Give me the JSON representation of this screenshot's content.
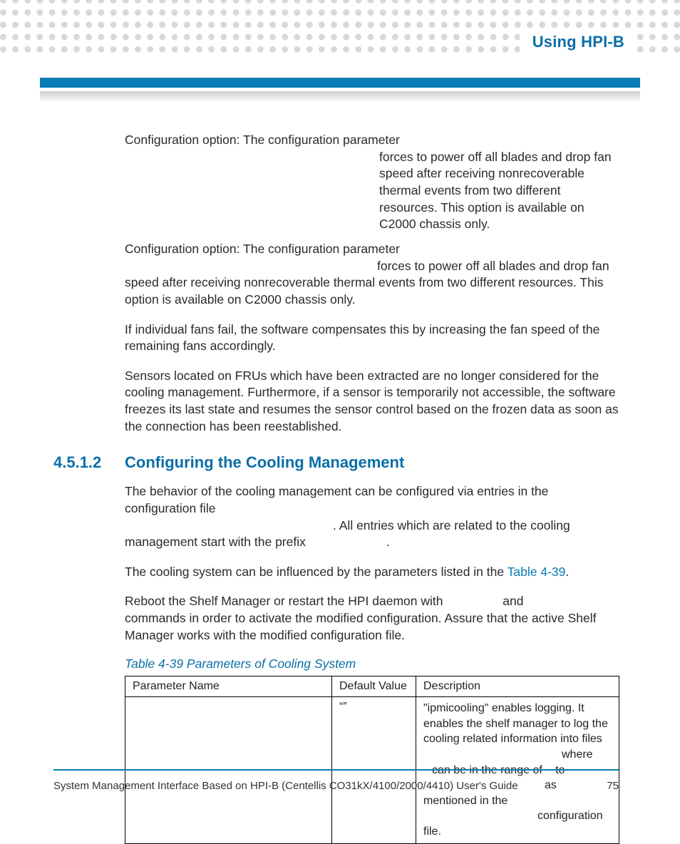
{
  "header": {
    "running_title": "Using HPI-B"
  },
  "section_number": "4.5.1.2",
  "section_title": "Configuring the Cooling Management",
  "paragraphs": {
    "p1": "Configuration option: The configuration parameter",
    "p1b": "forces to power off all blades and drop fan speed after receiving nonrecoverable thermal events from two different resources.  This option is available on C2000 chassis only.",
    "p2": "If individual fans fail, the software compensates this by increasing the fan speed of the remaining fans accordingly.",
    "p3": "Sensors located on FRUs which have been extracted are no longer considered for the cooling management. Furthermore, if a sensor is temporarily not accessible, the software freezes its last state and resumes the sensor control based on the frozen data as soon as the connection has been reestablished.",
    "p4a": "The behavior of the cooling management can be configured via entries in the configuration file",
    "p4b": ". All entries which are related to the cooling management start with the prefix",
    "p4c": ".",
    "p5a": "The cooling system can be influenced by the parameters listed in the ",
    "p5_link": "Table 4-39",
    "p5b": ".",
    "p6a": "Reboot the Shelf Manager or restart the HPI daemon with",
    "p6b": "and",
    "p6c": "commands in order to activate the modified configuration.   Assure that the active Shelf Manager works with the modified configuration file."
  },
  "table": {
    "caption": "Table 4-39 Parameters of Cooling System",
    "headers": {
      "param": "Parameter Name",
      "def": "Default Value",
      "desc": "Description"
    },
    "rows": [
      {
        "param": "",
        "def": "“”",
        "desc_a": "\"ipmicooling\" enables logging. It enables the shelf manager to log the cooling related information into files",
        "desc_b": "where",
        "desc_c": "can be in the range of",
        "desc_d": "to",
        "desc_e": "as mentioned in the",
        "desc_f": "configuration file."
      }
    ]
  },
  "footer": {
    "doc_title": "System Management Interface Based on HPI-B (Centellis CO31kX/4100/2000/4410) User's Guide",
    "page_number": "75"
  }
}
